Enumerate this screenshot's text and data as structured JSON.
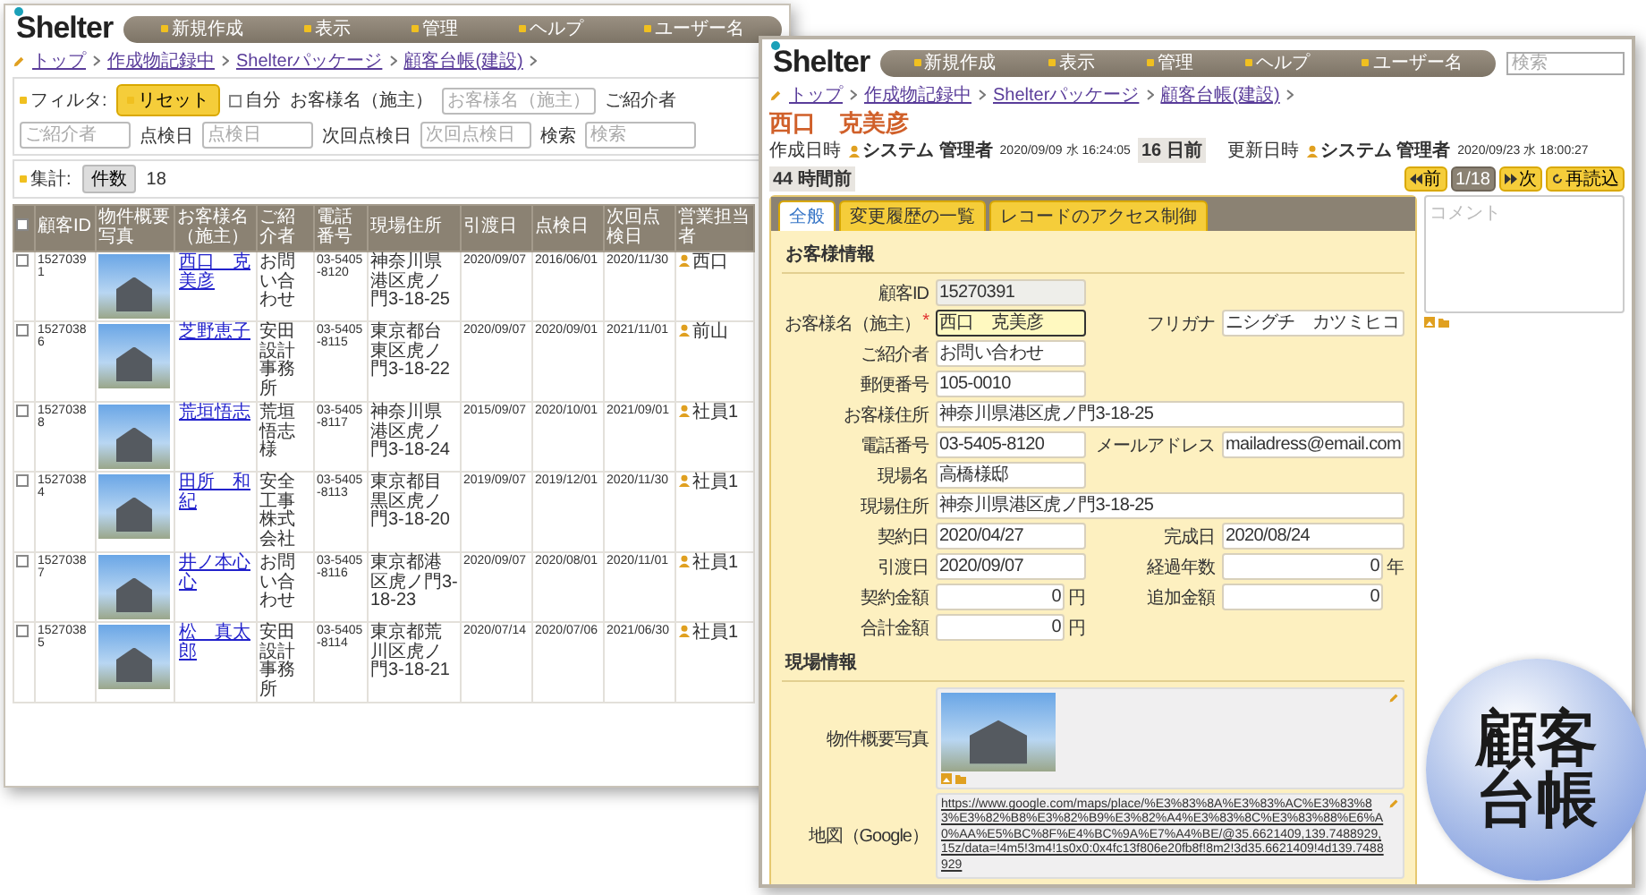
{
  "left_window": {
    "logo": "Shelter",
    "menu": [
      "新規作成",
      "表示",
      "管理",
      "ヘルプ",
      "ユーザー名"
    ],
    "breadcrumbs": [
      "トップ",
      "作成物記録中",
      "Shelterパッケージ",
      "顧客台帳(建設)"
    ],
    "filter": {
      "label": "フィルタ:",
      "reset": "リセット",
      "mine": {
        "label": "自分",
        "checked": false
      },
      "fields": [
        {
          "label": "お客様名（施主）",
          "placeholder": "お客様名（施主）"
        },
        {
          "label": "ご紹介者",
          "placeholder": "ご紹介者"
        },
        {
          "label": "点検日",
          "placeholder": "点検日"
        },
        {
          "label": "次回点検日",
          "placeholder": "次回点検日"
        },
        {
          "label": "検索",
          "placeholder": "検索"
        }
      ]
    },
    "summary": {
      "label": "集計:",
      "button": "件数",
      "count": "18"
    },
    "table": {
      "all_checked": false,
      "columns": [
        "顧客ID",
        "物件概要写真",
        "お客様名（施主）",
        "ご紹介者",
        "電話番号",
        "現場住所",
        "引渡日",
        "点検日",
        "次回点検日",
        "営業担当者"
      ],
      "rows": [
        {
          "checked": false,
          "id": "15270391",
          "name": "西口　克美彦",
          "referrer": "お問い合わせ",
          "phone": "03-5405-8120",
          "address": "神奈川県港区虎ノ門3-18-25",
          "handover": "2020/09/07",
          "inspection": "2016/06/01",
          "next_inspection": "2020/11/30",
          "sales": "西口"
        },
        {
          "checked": false,
          "id": "15270386",
          "name": "芝野恵子",
          "referrer": "安田設計事務所",
          "phone": "03-5405-8115",
          "address": "東京都台東区虎ノ門3-18-22",
          "handover": "2020/09/07",
          "inspection": "2020/09/01",
          "next_inspection": "2021/11/01",
          "sales": "前山"
        },
        {
          "checked": false,
          "id": "15270388",
          "name": "荒垣悟志",
          "referrer": "荒垣悟志様",
          "phone": "03-5405-8117",
          "address": "神奈川県港区虎ノ門3-18-24",
          "handover": "2015/09/07",
          "inspection": "2020/10/01",
          "next_inspection": "2021/09/01",
          "sales": "社員1"
        },
        {
          "checked": false,
          "id": "15270384",
          "name": "田所　和紀",
          "referrer": "安全工事株式会社",
          "phone": "03-5405-8113",
          "address": "東京都目黒区虎ノ門3-18-20",
          "handover": "2019/09/07",
          "inspection": "2019/12/01",
          "next_inspection": "2020/11/30",
          "sales": "社員1"
        },
        {
          "checked": false,
          "id": "15270387",
          "name": "井ノ本心心",
          "referrer": "お問い合わせ",
          "phone": "03-5405-8116",
          "address": "東京都港区虎ノ門3-18-23",
          "handover": "2020/09/07",
          "inspection": "2020/08/01",
          "next_inspection": "2020/11/01",
          "sales": "社員1"
        },
        {
          "checked": false,
          "id": "15270385",
          "name": "松　真太郎",
          "referrer": "安田設計事務所",
          "phone": "03-5405-8114",
          "address": "東京都荒川区虎ノ門3-18-21",
          "handover": "2020/07/14",
          "inspection": "2020/07/06",
          "next_inspection": "2021/06/30",
          "sales": "社員1"
        }
      ]
    }
  },
  "right_window": {
    "logo": "Shelter",
    "menu": [
      "新規作成",
      "表示",
      "管理",
      "ヘルプ",
      "ユーザー名"
    ],
    "search_placeholder": "検索",
    "breadcrumbs": [
      "トップ",
      "作成物記録中",
      "Shelterパッケージ",
      "顧客台帳(建設)"
    ],
    "title": "西口　克美彦",
    "meta": [
      {
        "label": "作成日時",
        "user": "システム 管理者",
        "datetime": "2020/09/09 水 16:24:05",
        "ago": "16 日前"
      },
      {
        "label": "更新日時",
        "user": "システム 管理者",
        "datetime": "2020/09/23 水 18:00:27",
        "ago": "44 時間前"
      }
    ],
    "nav": [
      {
        "kind": "prev",
        "label": "前"
      },
      {
        "kind": "counter",
        "label": "1/18"
      },
      {
        "kind": "next",
        "label": "次"
      },
      {
        "kind": "reload",
        "label": "再読込"
      }
    ],
    "tabs": [
      {
        "label": "全般",
        "selected": true
      },
      {
        "label": "変更履歴の一覧",
        "selected": false
      },
      {
        "label": "レコードのアクセス制御",
        "selected": false
      }
    ],
    "sections": [
      {
        "title": "お客様情報",
        "rows": [
          [
            {
              "kind": "readonly",
              "label": "顧客ID",
              "value": "15270391",
              "focused": false
            }
          ],
          [
            {
              "kind": "text",
              "label": "お客様名（施主）",
              "required_mark": "*",
              "value": "西口　克美彦",
              "focused": true
            },
            {
              "kind": "text",
              "label": "フリガナ",
              "value": "ニシグチ　カツミヒコ",
              "focused": false
            }
          ],
          [
            {
              "kind": "text",
              "label": "ご紹介者",
              "value": "お問い合わせ",
              "focused": false
            }
          ],
          [
            {
              "kind": "text",
              "label": "郵便番号",
              "value": "105-0010",
              "focused": false
            }
          ],
          [
            {
              "kind": "wide",
              "label": "お客様住所",
              "value": "神奈川県港区虎ノ門3-18-25",
              "focused": false
            }
          ],
          [
            {
              "kind": "text",
              "label": "電話番号",
              "value": "03-5405-8120",
              "focused": false
            },
            {
              "kind": "text",
              "label": "メールアドレス",
              "value": "mailadress@email.com",
              "focused": false
            }
          ],
          [
            {
              "kind": "text",
              "label": "現場名",
              "value": "高橋様邸",
              "focused": false
            }
          ],
          [
            {
              "kind": "wide",
              "label": "現場住所",
              "value": "神奈川県港区虎ノ門3-18-25",
              "focused": false
            }
          ],
          [
            {
              "kind": "text",
              "label": "契約日",
              "value": "2020/04/27",
              "focused": false
            },
            {
              "kind": "text",
              "label": "完成日",
              "value": "2020/08/24",
              "focused": false
            }
          ],
          [
            {
              "kind": "text",
              "label": "引渡日",
              "value": "2020/09/07",
              "focused": false
            },
            {
              "kind": "number",
              "label": "経過年数",
              "value": "0",
              "unit": "年",
              "focused": false
            }
          ],
          [
            {
              "kind": "number",
              "label": "契約金額",
              "value": "0",
              "unit": "円",
              "focused": false
            },
            {
              "kind": "number",
              "label": "追加金額",
              "value": "0",
              "focused": false
            }
          ],
          [
            {
              "kind": "number",
              "label": "合計金額",
              "value": "0",
              "unit": "円",
              "focused": false
            }
          ]
        ]
      },
      {
        "title": "現場情報",
        "rows": [
          [
            {
              "kind": "photo",
              "label": "物件概要写真",
              "focused": false
            }
          ],
          [
            {
              "kind": "link",
              "label": "地図（Google）",
              "value": "https://www.google.com/maps/place/%E3%83%8A%E3%83%AC%E3%83%83%E3%82%B8%E3%82%B9%E3%82%A4%E3%83%8C%E3%83%88%E6%A0%AA%E5%BC%8F%E4%BC%9A%E7%A4%BE/@35.6621409,139.7488929,15z/data=!4m5!3m4!1s0x0:0x4fc13f806e20fb8f!8m2!3d35.6621409!4d139.7488929",
              "focused": false
            }
          ]
        ]
      }
    ],
    "comment_placeholder": "コメント"
  },
  "badge": {
    "lines": [
      "顧客",
      "台帳"
    ]
  }
}
